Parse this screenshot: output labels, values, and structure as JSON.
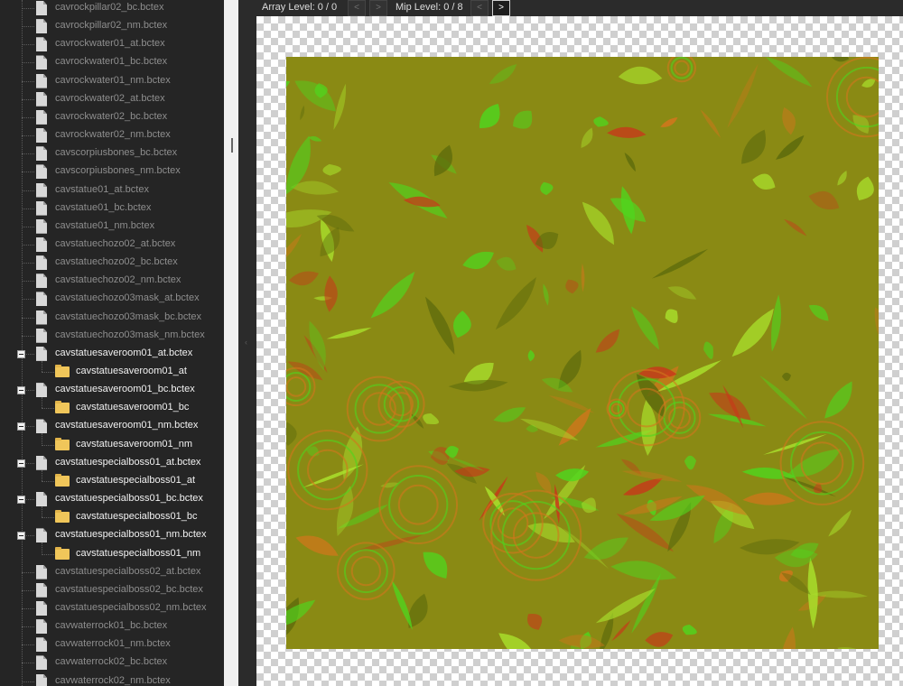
{
  "tree": {
    "items": [
      {
        "label": "cavrockpillar02_bc.bctex",
        "type": "file",
        "level": 0,
        "state": "dim"
      },
      {
        "label": "cavrockpillar02_nm.bctex",
        "type": "file",
        "level": 0,
        "state": "dim"
      },
      {
        "label": "cavrockwater01_at.bctex",
        "type": "file",
        "level": 0,
        "state": "dim"
      },
      {
        "label": "cavrockwater01_bc.bctex",
        "type": "file",
        "level": 0,
        "state": "dim"
      },
      {
        "label": "cavrockwater01_nm.bctex",
        "type": "file",
        "level": 0,
        "state": "dim"
      },
      {
        "label": "cavrockwater02_at.bctex",
        "type": "file",
        "level": 0,
        "state": "dim"
      },
      {
        "label": "cavrockwater02_bc.bctex",
        "type": "file",
        "level": 0,
        "state": "dim"
      },
      {
        "label": "cavrockwater02_nm.bctex",
        "type": "file",
        "level": 0,
        "state": "dim"
      },
      {
        "label": "cavscorpiusbones_bc.bctex",
        "type": "file",
        "level": 0,
        "state": "dim"
      },
      {
        "label": "cavscorpiusbones_nm.bctex",
        "type": "file",
        "level": 0,
        "state": "dim"
      },
      {
        "label": "cavstatue01_at.bctex",
        "type": "file",
        "level": 0,
        "state": "dim"
      },
      {
        "label": "cavstatue01_bc.bctex",
        "type": "file",
        "level": 0,
        "state": "dim"
      },
      {
        "label": "cavstatue01_nm.bctex",
        "type": "file",
        "level": 0,
        "state": "dim"
      },
      {
        "label": "cavstatuechozo02_at.bctex",
        "type": "file",
        "level": 0,
        "state": "dim"
      },
      {
        "label": "cavstatuechozo02_bc.bctex",
        "type": "file",
        "level": 0,
        "state": "dim"
      },
      {
        "label": "cavstatuechozo02_nm.bctex",
        "type": "file",
        "level": 0,
        "state": "dim"
      },
      {
        "label": "cavstatuechozo03mask_at.bctex",
        "type": "file",
        "level": 0,
        "state": "dim"
      },
      {
        "label": "cavstatuechozo03mask_bc.bctex",
        "type": "file",
        "level": 0,
        "state": "dim"
      },
      {
        "label": "cavstatuechozo03mask_nm.bctex",
        "type": "file",
        "level": 0,
        "state": "dim"
      },
      {
        "label": "cavstatuesaveroom01_at.bctex",
        "type": "file",
        "level": 0,
        "state": "expanded"
      },
      {
        "label": "cavstatuesaveroom01_at",
        "type": "folder",
        "level": 1,
        "state": "child"
      },
      {
        "label": "cavstatuesaveroom01_bc.bctex",
        "type": "file",
        "level": 0,
        "state": "expanded"
      },
      {
        "label": "cavstatuesaveroom01_bc",
        "type": "folder",
        "level": 1,
        "state": "child"
      },
      {
        "label": "cavstatuesaveroom01_nm.bctex",
        "type": "file",
        "level": 0,
        "state": "expanded"
      },
      {
        "label": "cavstatuesaveroom01_nm",
        "type": "folder",
        "level": 1,
        "state": "child"
      },
      {
        "label": "cavstatuespecialboss01_at.bctex",
        "type": "file",
        "level": 0,
        "state": "expanded"
      },
      {
        "label": "cavstatuespecialboss01_at",
        "type": "folder",
        "level": 1,
        "state": "child"
      },
      {
        "label": "cavstatuespecialboss01_bc.bctex",
        "type": "file",
        "level": 0,
        "state": "expanded"
      },
      {
        "label": "cavstatuespecialboss01_bc",
        "type": "folder",
        "level": 1,
        "state": "child"
      },
      {
        "label": "cavstatuespecialboss01_nm.bctex",
        "type": "file",
        "level": 0,
        "state": "expanded"
      },
      {
        "label": "cavstatuespecialboss01_nm",
        "type": "folder",
        "level": 1,
        "state": "child"
      },
      {
        "label": "cavstatuespecialboss02_at.bctex",
        "type": "file",
        "level": 0,
        "state": "dim"
      },
      {
        "label": "cavstatuespecialboss02_bc.bctex",
        "type": "file",
        "level": 0,
        "state": "dim"
      },
      {
        "label": "cavstatuespecialboss02_nm.bctex",
        "type": "file",
        "level": 0,
        "state": "dim"
      },
      {
        "label": "cavwaterrock01_bc.bctex",
        "type": "file",
        "level": 0,
        "state": "dim"
      },
      {
        "label": "cavwaterrock01_nm.bctex",
        "type": "file",
        "level": 0,
        "state": "dim"
      },
      {
        "label": "cavwaterrock02_bc.bctex",
        "type": "file",
        "level": 0,
        "state": "dim"
      },
      {
        "label": "cavwaterrock02_nm.bctex",
        "type": "file",
        "level": 0,
        "state": "dim"
      }
    ]
  },
  "toolbar": {
    "array_level_label": "Array Level: 0 / 0",
    "mip_level_label": "Mip Level: 0 / 8",
    "prev_glyph": "<",
    "next_glyph": ">"
  },
  "viewer": {
    "collapse_glyph": "‹",
    "texture_colors": {
      "base": "#8a8a14",
      "green": "#4fd61e",
      "lime": "#a9e02c",
      "orange": "#d2761c",
      "red": "#c9361a",
      "dark": "#5c6a0c"
    }
  }
}
